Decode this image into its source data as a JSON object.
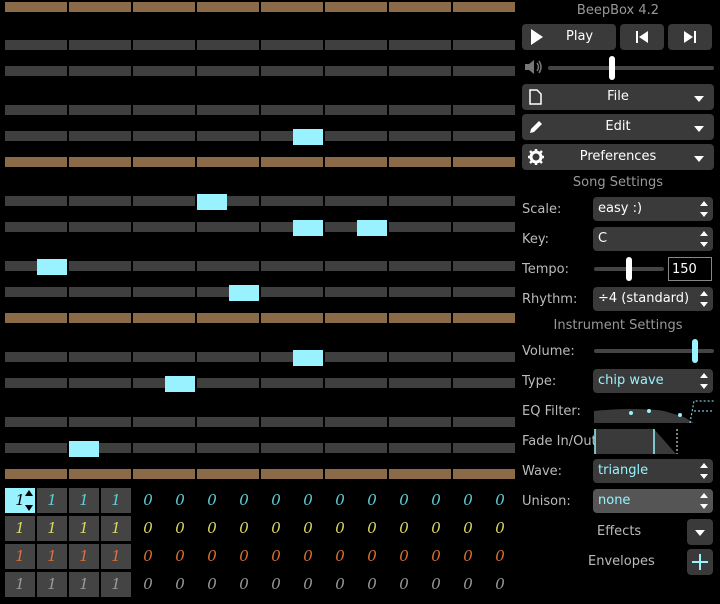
{
  "app_title": "BeepBox 4.2",
  "transport": {
    "play_label": "Play"
  },
  "volume_level": 0.38,
  "menus": {
    "file": "File",
    "edit": "Edit",
    "preferences": "Preferences"
  },
  "song_settings": {
    "heading": "Song Settings",
    "scale_label": "Scale:",
    "scale_value": "easy :)",
    "key_label": "Key:",
    "key_value": "C",
    "tempo_label": "Tempo:",
    "tempo_value": "150",
    "rhythm_label": "Rhythm:",
    "rhythm_value": "÷4 (standard)"
  },
  "instrument_settings": {
    "heading": "Instrument Settings",
    "volume_label": "Volume:",
    "type_label": "Type:",
    "type_value": "chip wave",
    "eq_label": "EQ Filter:",
    "fade_label": "Fade In/Out:",
    "wave_label": "Wave:",
    "wave_value": "triangle",
    "unison_label": "Unison:",
    "unison_value": "none",
    "effects_label": "Effects",
    "envelopes_label": "Envelopes"
  },
  "colors": {
    "accent": "#98f2ff",
    "octave_row": "#8a6a47",
    "note_row": "#3f3f3f",
    "channel_colors": [
      "#5ecfd9",
      "#d9d95e",
      "#d9703d",
      "#9a9a9a"
    ]
  },
  "pattern_grid": {
    "rows": [
      [
        "1",
        "1",
        "1",
        "1",
        "0",
        "0",
        "0",
        "0",
        "0",
        "0",
        "0",
        "0",
        "0",
        "0",
        "0",
        "0"
      ],
      [
        "1",
        "1",
        "1",
        "1",
        "0",
        "0",
        "0",
        "0",
        "0",
        "0",
        "0",
        "0",
        "0",
        "0",
        "0",
        "0"
      ],
      [
        "1",
        "1",
        "1",
        "1",
        "0",
        "0",
        "0",
        "0",
        "0",
        "0",
        "0",
        "0",
        "0",
        "0",
        "0",
        "0"
      ],
      [
        "1",
        "1",
        "1",
        "1",
        "0",
        "0",
        "0",
        "0",
        "0",
        "0",
        "0",
        "0",
        "0",
        "0",
        "0",
        "0"
      ]
    ],
    "filled_bars": 4,
    "selected": [
      0,
      0
    ]
  }
}
